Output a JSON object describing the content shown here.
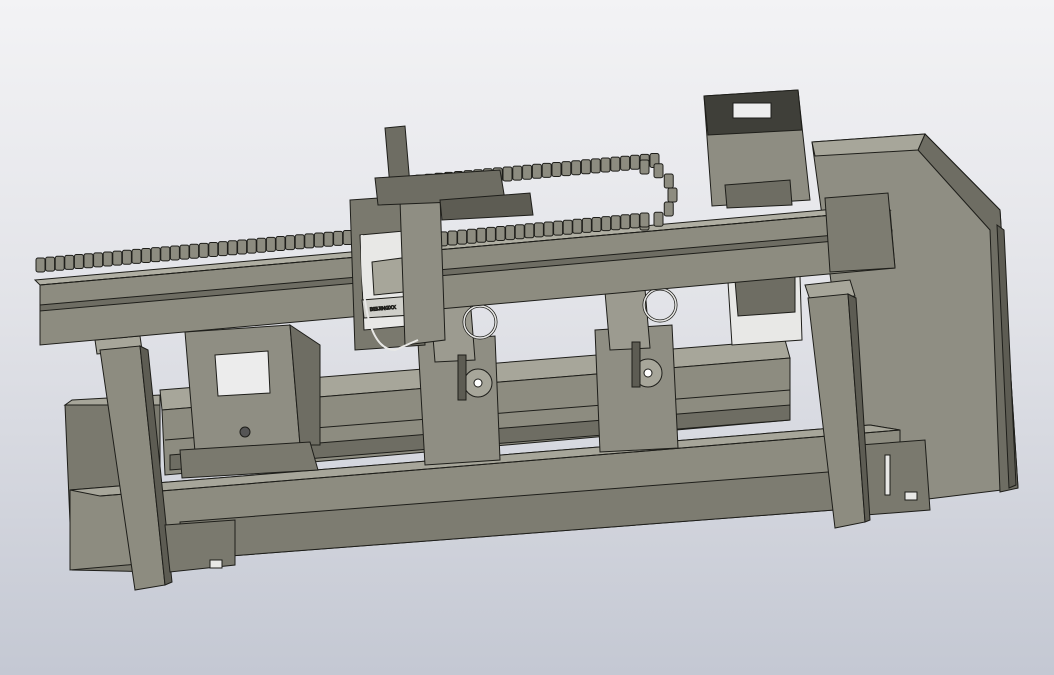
{
  "viewport": {
    "background_top": "#f3f3f5",
    "background_bottom": "#c4c8d3"
  },
  "model": {
    "body_color": "#8d8c80",
    "shade_color": "#6e6d63",
    "light_color": "#a7a69a",
    "edge_color": "#1e1e1a",
    "white_panel_color": "#e8e8e6",
    "components": [
      "base-frame",
      "linear-rail",
      "support-column-left",
      "support-column-right",
      "gantry-beam",
      "cable-chain",
      "torch-carriage",
      "chuck-left",
      "chuck-right",
      "motor-enclosure",
      "electrical-cabinet",
      "pedestal-block"
    ]
  },
  "carriage_label": {
    "text": "BEIJINGXX"
  }
}
